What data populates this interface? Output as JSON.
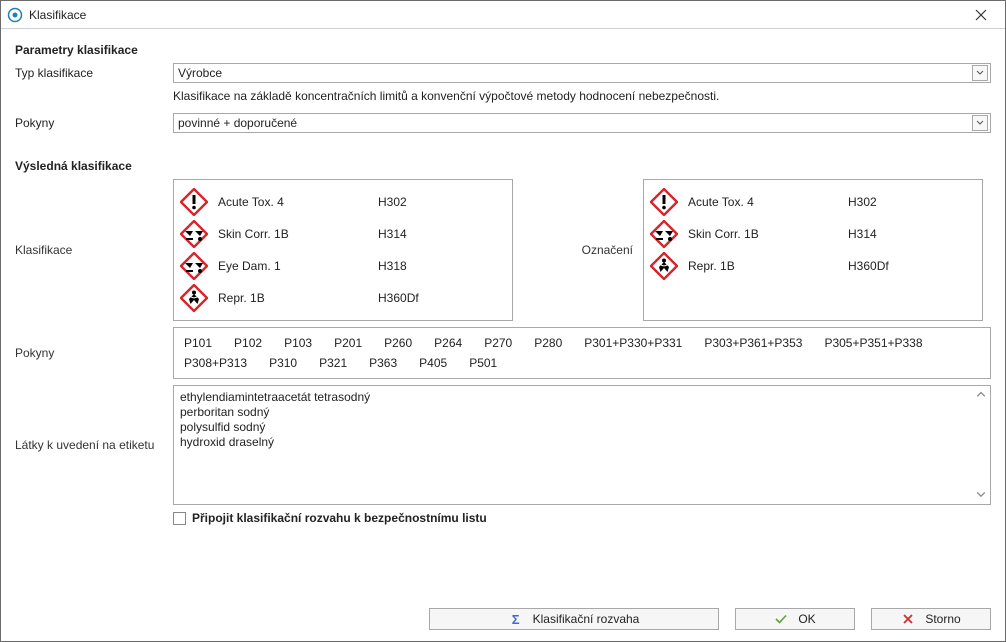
{
  "window": {
    "title": "Klasifikace"
  },
  "params": {
    "section_title": "Parametry klasifikace",
    "type_label": "Typ klasifikace",
    "type_value": "Výrobce",
    "type_hint": "Klasifikace na základě koncentračních limitů a konvenční výpočtové metody hodnocení nebezpečnosti.",
    "instructions_label": "Pokyny",
    "instructions_value": "povinné + doporučené"
  },
  "results": {
    "section_title": "Výsledná klasifikace",
    "classification_label": "Klasifikace",
    "labelling_label": "Označení",
    "pcodes_label": "Pokyny",
    "substances_label": "Látky k uvedení na etiketu",
    "classification": [
      {
        "pict": "exclam",
        "name": "Acute Tox. 4",
        "code": "H302"
      },
      {
        "pict": "corr",
        "name": "Skin Corr. 1B",
        "code": "H314"
      },
      {
        "pict": "corr",
        "name": "Eye Dam. 1",
        "code": "H318"
      },
      {
        "pict": "health",
        "name": "Repr. 1B",
        "code": "H360Df"
      }
    ],
    "labelling": [
      {
        "pict": "exclam",
        "name": "Acute Tox. 4",
        "code": "H302"
      },
      {
        "pict": "corr",
        "name": "Skin Corr. 1B",
        "code": "H314"
      },
      {
        "pict": "health",
        "name": "Repr. 1B",
        "code": "H360Df"
      }
    ],
    "pcodes": [
      "P101",
      "P102",
      "P103",
      "P201",
      "P260",
      "P264",
      "P270",
      "P280",
      "P301+P330+P331",
      "P303+P361+P353",
      "P305+P351+P338",
      "P308+P313",
      "P310",
      "P321",
      "P363",
      "P405",
      "P501"
    ],
    "substances": [
      "ethylendiamintetraacetát tetrasodný",
      "perboritan sodný",
      "polysulfid sodný",
      "hydroxid draselný"
    ],
    "attach_checkbox_label": "Připojit klasifikační rozvahu k bezpečnostnímu listu",
    "attach_checked": false
  },
  "footer": {
    "reasoning_label": "Klasifikační rozvaha",
    "ok_label": "OK",
    "cancel_label": "Storno"
  },
  "icons": {
    "app": "app-icon",
    "close": "close-icon",
    "dropdown": "chevron-down-icon",
    "scroll_up": "chevron-up-icon",
    "scroll_down": "chevron-down-icon",
    "sum": "sigma-icon",
    "check": "check-icon",
    "x": "x-icon"
  }
}
